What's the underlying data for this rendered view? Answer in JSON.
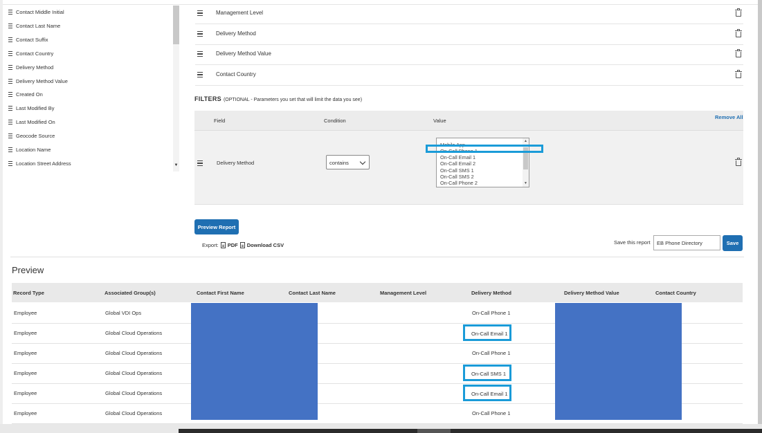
{
  "field_list": {
    "items": [
      "Contact Middle Initial",
      "Contact Last Name",
      "Contact Suffix",
      "Contact Country",
      "Delivery Method",
      "Delivery Method Value",
      "Created On",
      "Last Modified By",
      "Last Modified On",
      "Geocode Source",
      "Location Name",
      "Location Street Address"
    ]
  },
  "selected_columns": [
    "Management Level",
    "Delivery Method",
    "Delivery Method Value",
    "Contact Country"
  ],
  "filters": {
    "title": "FILTERS",
    "subtitle": "(OPTIONAL - Parameters you set that will limit the data you see)",
    "headers": {
      "field": "Field",
      "condition": "Condition",
      "value": "Value"
    },
    "remove_all": "Remove All",
    "row": {
      "field": "Delivery Method",
      "condition": "contains",
      "value_options": [
        "Mobile App",
        "On-Call Phone 1",
        "On-Call Email 1",
        "On-Call Email 2",
        "On-Call SMS 1",
        "On-Call SMS 2",
        "On-Call Phone 2"
      ],
      "selected_value": "On-Call Phone 1"
    }
  },
  "actions": {
    "preview_button": "Preview Report",
    "export_label": "Export:",
    "export_pdf": "PDF",
    "export_csv": "Download CSV",
    "save_label": "Save this report",
    "save_name": "EB Phone Directory",
    "save_button": "Save"
  },
  "preview": {
    "title": "Preview",
    "columns": [
      "Record Type",
      "Associated Group(s)",
      "Contact First Name",
      "Contact Last Name",
      "Management Level",
      "Delivery Method",
      "Delivery Method Value",
      "Contact Country"
    ],
    "rows": [
      {
        "record_type": "Employee",
        "group": "Global VDI Ops",
        "delivery_method": "On-Call Phone 1",
        "highlighted": false
      },
      {
        "record_type": "Employee",
        "group": "Global Cloud Operations",
        "delivery_method": "On-Call Email 1",
        "highlighted": true
      },
      {
        "record_type": "Employee",
        "group": "Global Cloud Operations",
        "delivery_method": "On-Call Phone 1",
        "highlighted": false
      },
      {
        "record_type": "Employee",
        "group": "Global Cloud Operations",
        "delivery_method": "On-Call SMS 1",
        "highlighted": true
      },
      {
        "record_type": "Employee",
        "group": "Global Cloud Operations",
        "delivery_method": "On-Call Email 1",
        "highlighted": true
      },
      {
        "record_type": "Employee",
        "group": "Global Cloud Operations",
        "delivery_method": "On-Call Phone 1",
        "highlighted": false
      }
    ]
  },
  "colors": {
    "accent": "#1f6fb2",
    "highlight": "#1a9bd8",
    "redaction": "#4472c4"
  },
  "icons": {
    "drag_handle": "hamburger-icon",
    "delete": "trash-icon",
    "pdf": "pdf-icon",
    "csv": "csv-icon"
  }
}
